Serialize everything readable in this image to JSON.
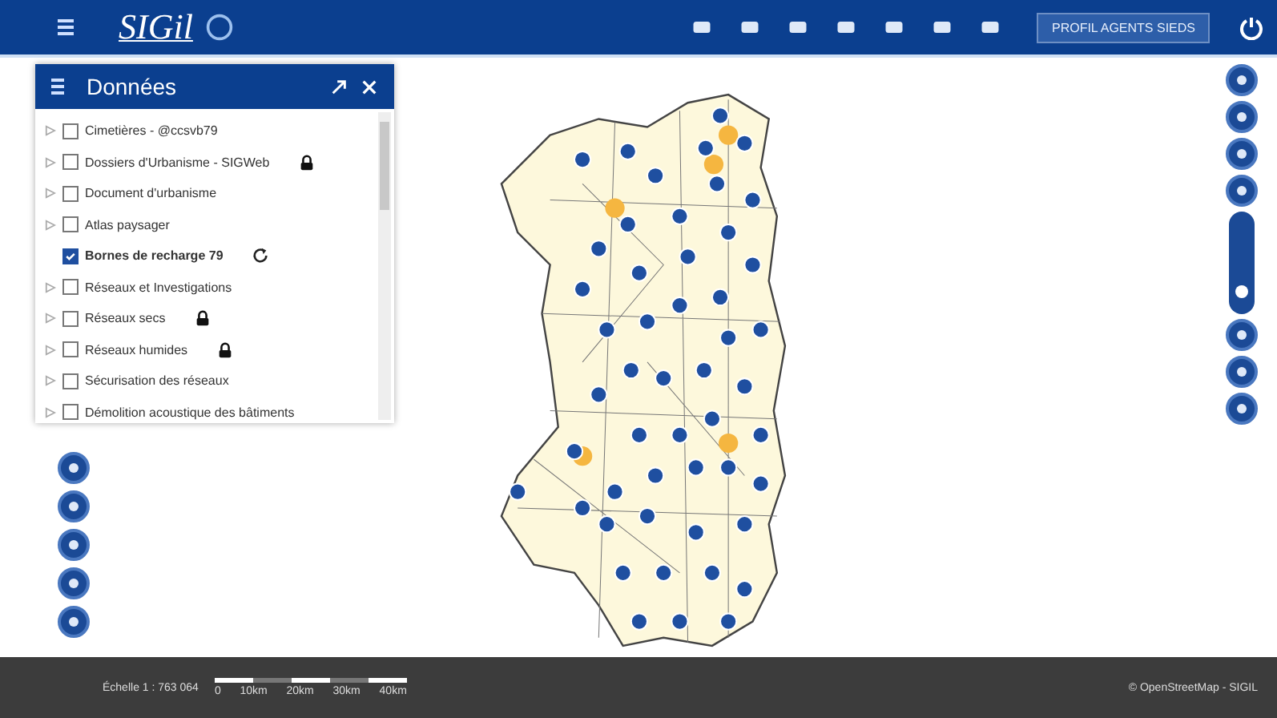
{
  "header": {
    "logo": "SIGil",
    "profile_button": "PROFIL AGENTS SIEDS"
  },
  "layers_panel": {
    "title": "Données",
    "layers": [
      {
        "label": "Cimetières - @ccsvb79",
        "checked": false,
        "expandable": true
      },
      {
        "label": "Dossiers d'Urbanisme - SIGWeb",
        "checked": false,
        "expandable": true,
        "locked": true
      },
      {
        "label": "Document d'urbanisme",
        "checked": false,
        "expandable": true
      },
      {
        "label": "Atlas paysager",
        "checked": false,
        "expandable": true
      },
      {
        "label": "Bornes de recharge 79",
        "checked": true,
        "expandable": false,
        "refreshable": true
      },
      {
        "label": "Réseaux et Investigations",
        "checked": false,
        "expandable": true
      },
      {
        "label": "Réseaux secs",
        "checked": false,
        "expandable": true,
        "locked": true
      },
      {
        "label": "Réseaux humides",
        "checked": false,
        "expandable": true,
        "locked": true
      },
      {
        "label": "Sécurisation des réseaux",
        "checked": false,
        "expandable": true
      },
      {
        "label": "Démolition acoustique des bâtiments",
        "checked": false,
        "expandable": true
      }
    ]
  },
  "zoom_slider": {
    "level": 0.15
  },
  "footer": {
    "scale": "Échelle 1 : 763 064",
    "scale_ticks": [
      "0",
      "10km",
      "20km",
      "30km",
      "40km"
    ],
    "attribution": "© OpenStreetMap - SIGIL"
  }
}
